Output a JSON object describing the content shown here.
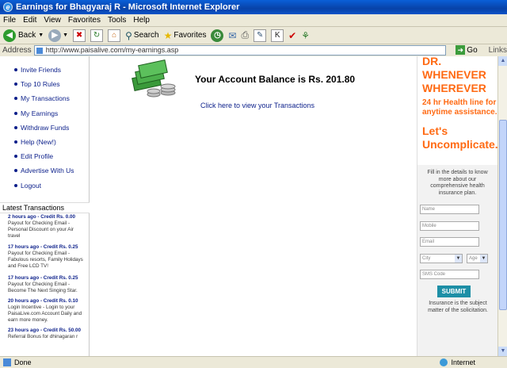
{
  "window": {
    "title": "Earnings for Bhagyaraj R - Microsoft Internet Explorer"
  },
  "menu": [
    "File",
    "Edit",
    "View",
    "Favorites",
    "Tools",
    "Help"
  ],
  "toolbar": {
    "back": "Back",
    "search": "Search",
    "favorites": "Favorites"
  },
  "address": {
    "label": "Address",
    "url": "http://www.paisalive.com/my-earnings.asp",
    "go": "Go",
    "links": "Links"
  },
  "nav": [
    "Invite Friends",
    "Top 10 Rules",
    "My Transactions",
    "My Earnings",
    "Withdraw Funds",
    "Help (New!)",
    "Edit Profile",
    "Advertise With Us",
    "Logout"
  ],
  "latest": {
    "heading": "Latest Transactions",
    "items": [
      {
        "head": "2 hours ago - Credit Rs. 0.00",
        "body": "Payout for Checking Email - Personal Discount on your Air travel"
      },
      {
        "head": "17 hours ago - Credit Rs. 0.25",
        "body": "Payout for Checking Email - Fabulous resorts, Family Holidays and Free LCD TV!"
      },
      {
        "head": "17 hours ago - Credit Rs. 0.25",
        "body": "Payout for Checking Email - Become The Next Singing Star."
      },
      {
        "head": "20 hours ago - Credit Rs. 0.10",
        "body": "Login Incentive - Login to your PaisaLive.com Account Daily and earn more money."
      },
      {
        "head": "23 hours ago - Credit Rs. 50.00",
        "body": "Referral Bonus for dhinagaran r"
      }
    ]
  },
  "main": {
    "balance": "Your Account Balance is Rs. 201.80",
    "view_link": "Click here to view your Transactions"
  },
  "ad": {
    "headline1": "DR. WHENEVER WHEREVER",
    "headline2": "24 hr Health line for anytime assistance.",
    "headline3": "Let's Uncomplicate.",
    "desc": "Fill in the details to know more about our comprehensive health insurance plan.",
    "name": "Name",
    "mobile": "Mobile",
    "email": "Email",
    "city": "City",
    "age": "Age",
    "sms": "SMS Code",
    "submit": "SUBMIT",
    "footer": "Insurance is the subject matter of the solicitation."
  },
  "status": {
    "left": "Done",
    "zone": "Internet"
  }
}
